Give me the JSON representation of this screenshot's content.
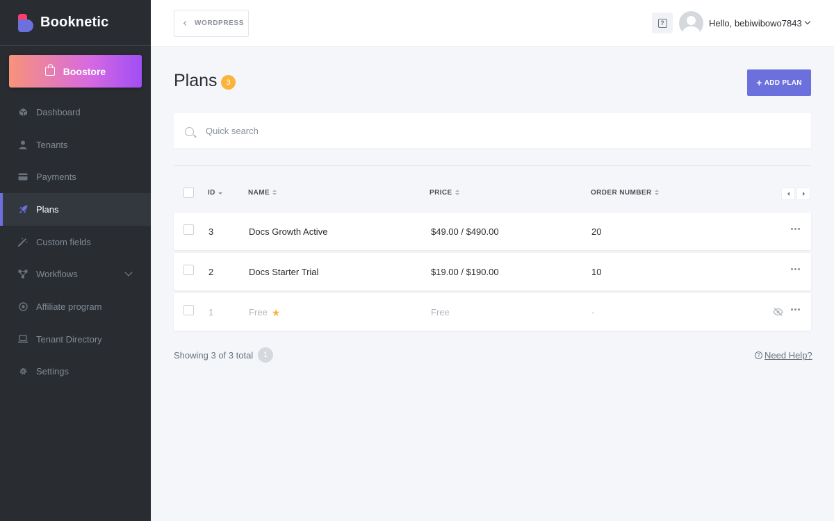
{
  "brand": {
    "name": "Booknetic"
  },
  "boostore": {
    "label": "Boostore"
  },
  "sidebar": {
    "items": [
      {
        "label": "Dashboard",
        "icon": "cube-icon"
      },
      {
        "label": "Tenants",
        "icon": "user-icon"
      },
      {
        "label": "Payments",
        "icon": "credit-card-icon"
      },
      {
        "label": "Plans",
        "icon": "rocket-icon",
        "active": true
      },
      {
        "label": "Custom fields",
        "icon": "magic-wand-icon"
      },
      {
        "label": "Workflows",
        "icon": "flow-icon",
        "expandable": true
      },
      {
        "label": "Affiliate program",
        "icon": "target-icon"
      },
      {
        "label": "Tenant Directory",
        "icon": "laptop-icon"
      },
      {
        "label": "Settings",
        "icon": "gear-icon"
      }
    ]
  },
  "topbar": {
    "back_label": "WORDPRESS",
    "user_greeting": "Hello, bebiwibowo7843"
  },
  "page": {
    "title": "Plans",
    "count": "3",
    "add_label": "ADD PLAN"
  },
  "search": {
    "placeholder": "Quick search"
  },
  "table": {
    "headers": {
      "id": "ID",
      "name": "NAME",
      "price": "PRICE",
      "order": "ORDER NUMBER"
    },
    "rows": [
      {
        "id": "3",
        "name": "Docs Growth Active",
        "price": "$49.00 / $490.00",
        "order": "20"
      },
      {
        "id": "2",
        "name": "Docs Starter Trial",
        "price": "$19.00 / $190.00",
        "order": "10"
      },
      {
        "id": "1",
        "name": "Free",
        "price": "Free",
        "order": "-",
        "hidden": true,
        "starred": true
      }
    ]
  },
  "footer": {
    "showing": "Showing 3 of 3 total",
    "page": "1",
    "help": "Need Help?"
  },
  "colors": {
    "accent": "#6c70dc",
    "badge": "#fbb33a",
    "sidebar_bg": "#292d32",
    "page_bg": "#f4f6fa"
  }
}
